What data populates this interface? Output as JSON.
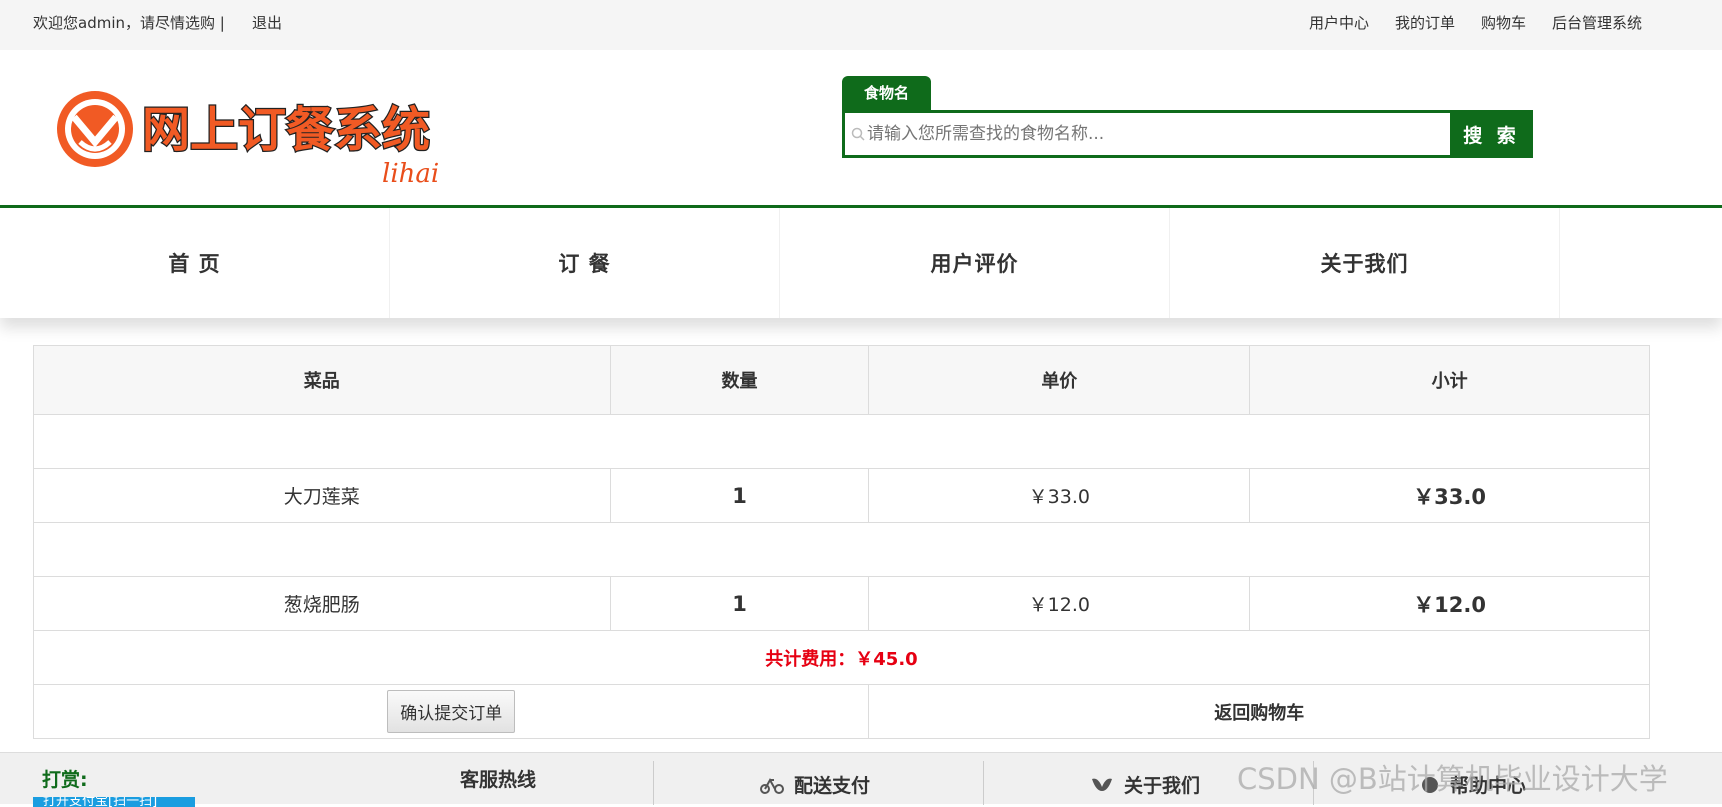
{
  "topbar": {
    "welcome": "欢迎您admin，请尽情选购 |",
    "logout": "退出",
    "links": [
      "用户中心",
      "我的订单",
      "购物车",
      "后台管理系统"
    ]
  },
  "logo": {
    "text": "网上订餐系统",
    "sub": "lihai"
  },
  "search": {
    "tab": "食物名",
    "placeholder": "请输入您所需查找的食物名称...",
    "button": "搜 索"
  },
  "nav": [
    "首 页",
    "订 餐",
    "用户评价",
    "关于我们"
  ],
  "cart": {
    "headers": [
      "菜品",
      "数量",
      "单价",
      "小计"
    ],
    "rows": [
      {
        "name": "大刀莲菜",
        "qty": "1",
        "price": "￥33.0",
        "subtotal": "￥33.0"
      },
      {
        "name": "葱烧肥肠",
        "qty": "1",
        "price": "￥12.0",
        "subtotal": "￥12.0"
      }
    ],
    "total": "共计费用：￥45.0",
    "submit": "确认提交订单",
    "back": "返回购物车"
  },
  "footer": {
    "tip": "打赏:",
    "alipay": "打开支付宝[扫一扫]",
    "cols": [
      "客服热线",
      "配送支付",
      "关于我们",
      "帮助中心"
    ]
  },
  "watermark": "CSDN @B站计算机毕业设计大学"
}
